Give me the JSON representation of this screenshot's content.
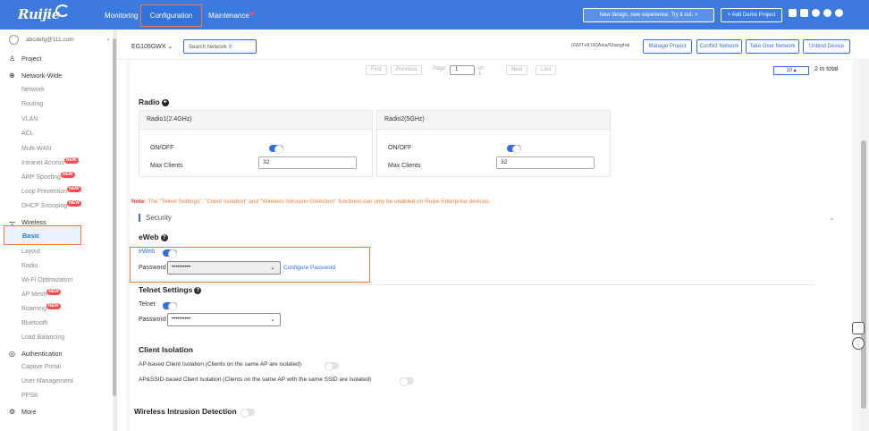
{
  "topbar": {
    "logo": "Ruijie",
    "nav": {
      "monitoring": "Monitoring",
      "configuration": "Configuration",
      "maintenance": "Maintenance"
    },
    "new_design": "New design, new experience. Try it out. >",
    "add_demo": "+ Add Demo Project",
    "accent": "#3c7ae0"
  },
  "sidebar": {
    "account": "abcdefg@111.com",
    "project": "Project",
    "network_wide": "Network-Wide",
    "nw_items": [
      "Network",
      "Routing",
      "VLAN",
      "ACL",
      "Multi-WAN",
      "Intranet Access",
      "ARP Spoofing",
      "Loop Prevention",
      "DHCP Snooping"
    ],
    "new_badge": "NEW",
    "wireless": "Wireless",
    "wl_items": [
      "Basic",
      "Layout",
      "Radio",
      "Wi-Fi Optimization",
      "AP Mesh",
      "Roaming",
      "Bluetooth",
      "Load Balancing"
    ],
    "authentication": "Authentication",
    "auth_items": [
      "Captive Portal",
      "User Management",
      "PPSK"
    ],
    "more": "More"
  },
  "toolbar": {
    "device": "EG105GWX",
    "search_placeholder": "Search Network",
    "timezone": "(GMT+8:00)Asia/Shanghai",
    "manage": "Manage Project",
    "conflict": "Conflict Network",
    "takeover": "Take Over Network",
    "unbind": "Unbind Device"
  },
  "pager": {
    "first": "First",
    "previous": "Previous",
    "page_label": "Page",
    "page": "1",
    "of": "of 1",
    "next": "Next",
    "last": "Last",
    "per_page": "10",
    "total": "2 in total"
  },
  "radio": {
    "title": "Radio",
    "bands": [
      {
        "name": "Radio1(2.4GHz)",
        "onoff": "ON/OFF",
        "max_label": "Max Clients",
        "max": "32",
        "on": true
      },
      {
        "name": "Radio2(5GHz)",
        "onoff": "ON/OFF",
        "max_label": "Max Clients",
        "max": "32",
        "on": true
      }
    ]
  },
  "note": {
    "prefix": "Note:",
    "text": " The \"Telnet Settings\", \"Client Isolation\" and \"Wireless Intrusion Detection\" functions can only be enabled on Ruijie Enterprise devices."
  },
  "security": {
    "title": "Security",
    "eweb": {
      "title": "eWeb",
      "toggle_label": "eWeb",
      "password_label": "Password",
      "password": "••••••••••",
      "configure": "Configure Password"
    },
    "telnet": {
      "title": "Telnet Settings",
      "toggle_label": "Telnet",
      "password_label": "Password",
      "password": "••••••••••"
    },
    "isolation": {
      "title": "Client Isolation",
      "ap": "AP-based Client Isolation (Clients on the same AP are isolated)",
      "ssid": "AP&SSID-based Client Isolation (Clients on the same AP with the same SSID are isolated)"
    },
    "wids": {
      "title": "Wireless Intrusion Detection"
    }
  }
}
